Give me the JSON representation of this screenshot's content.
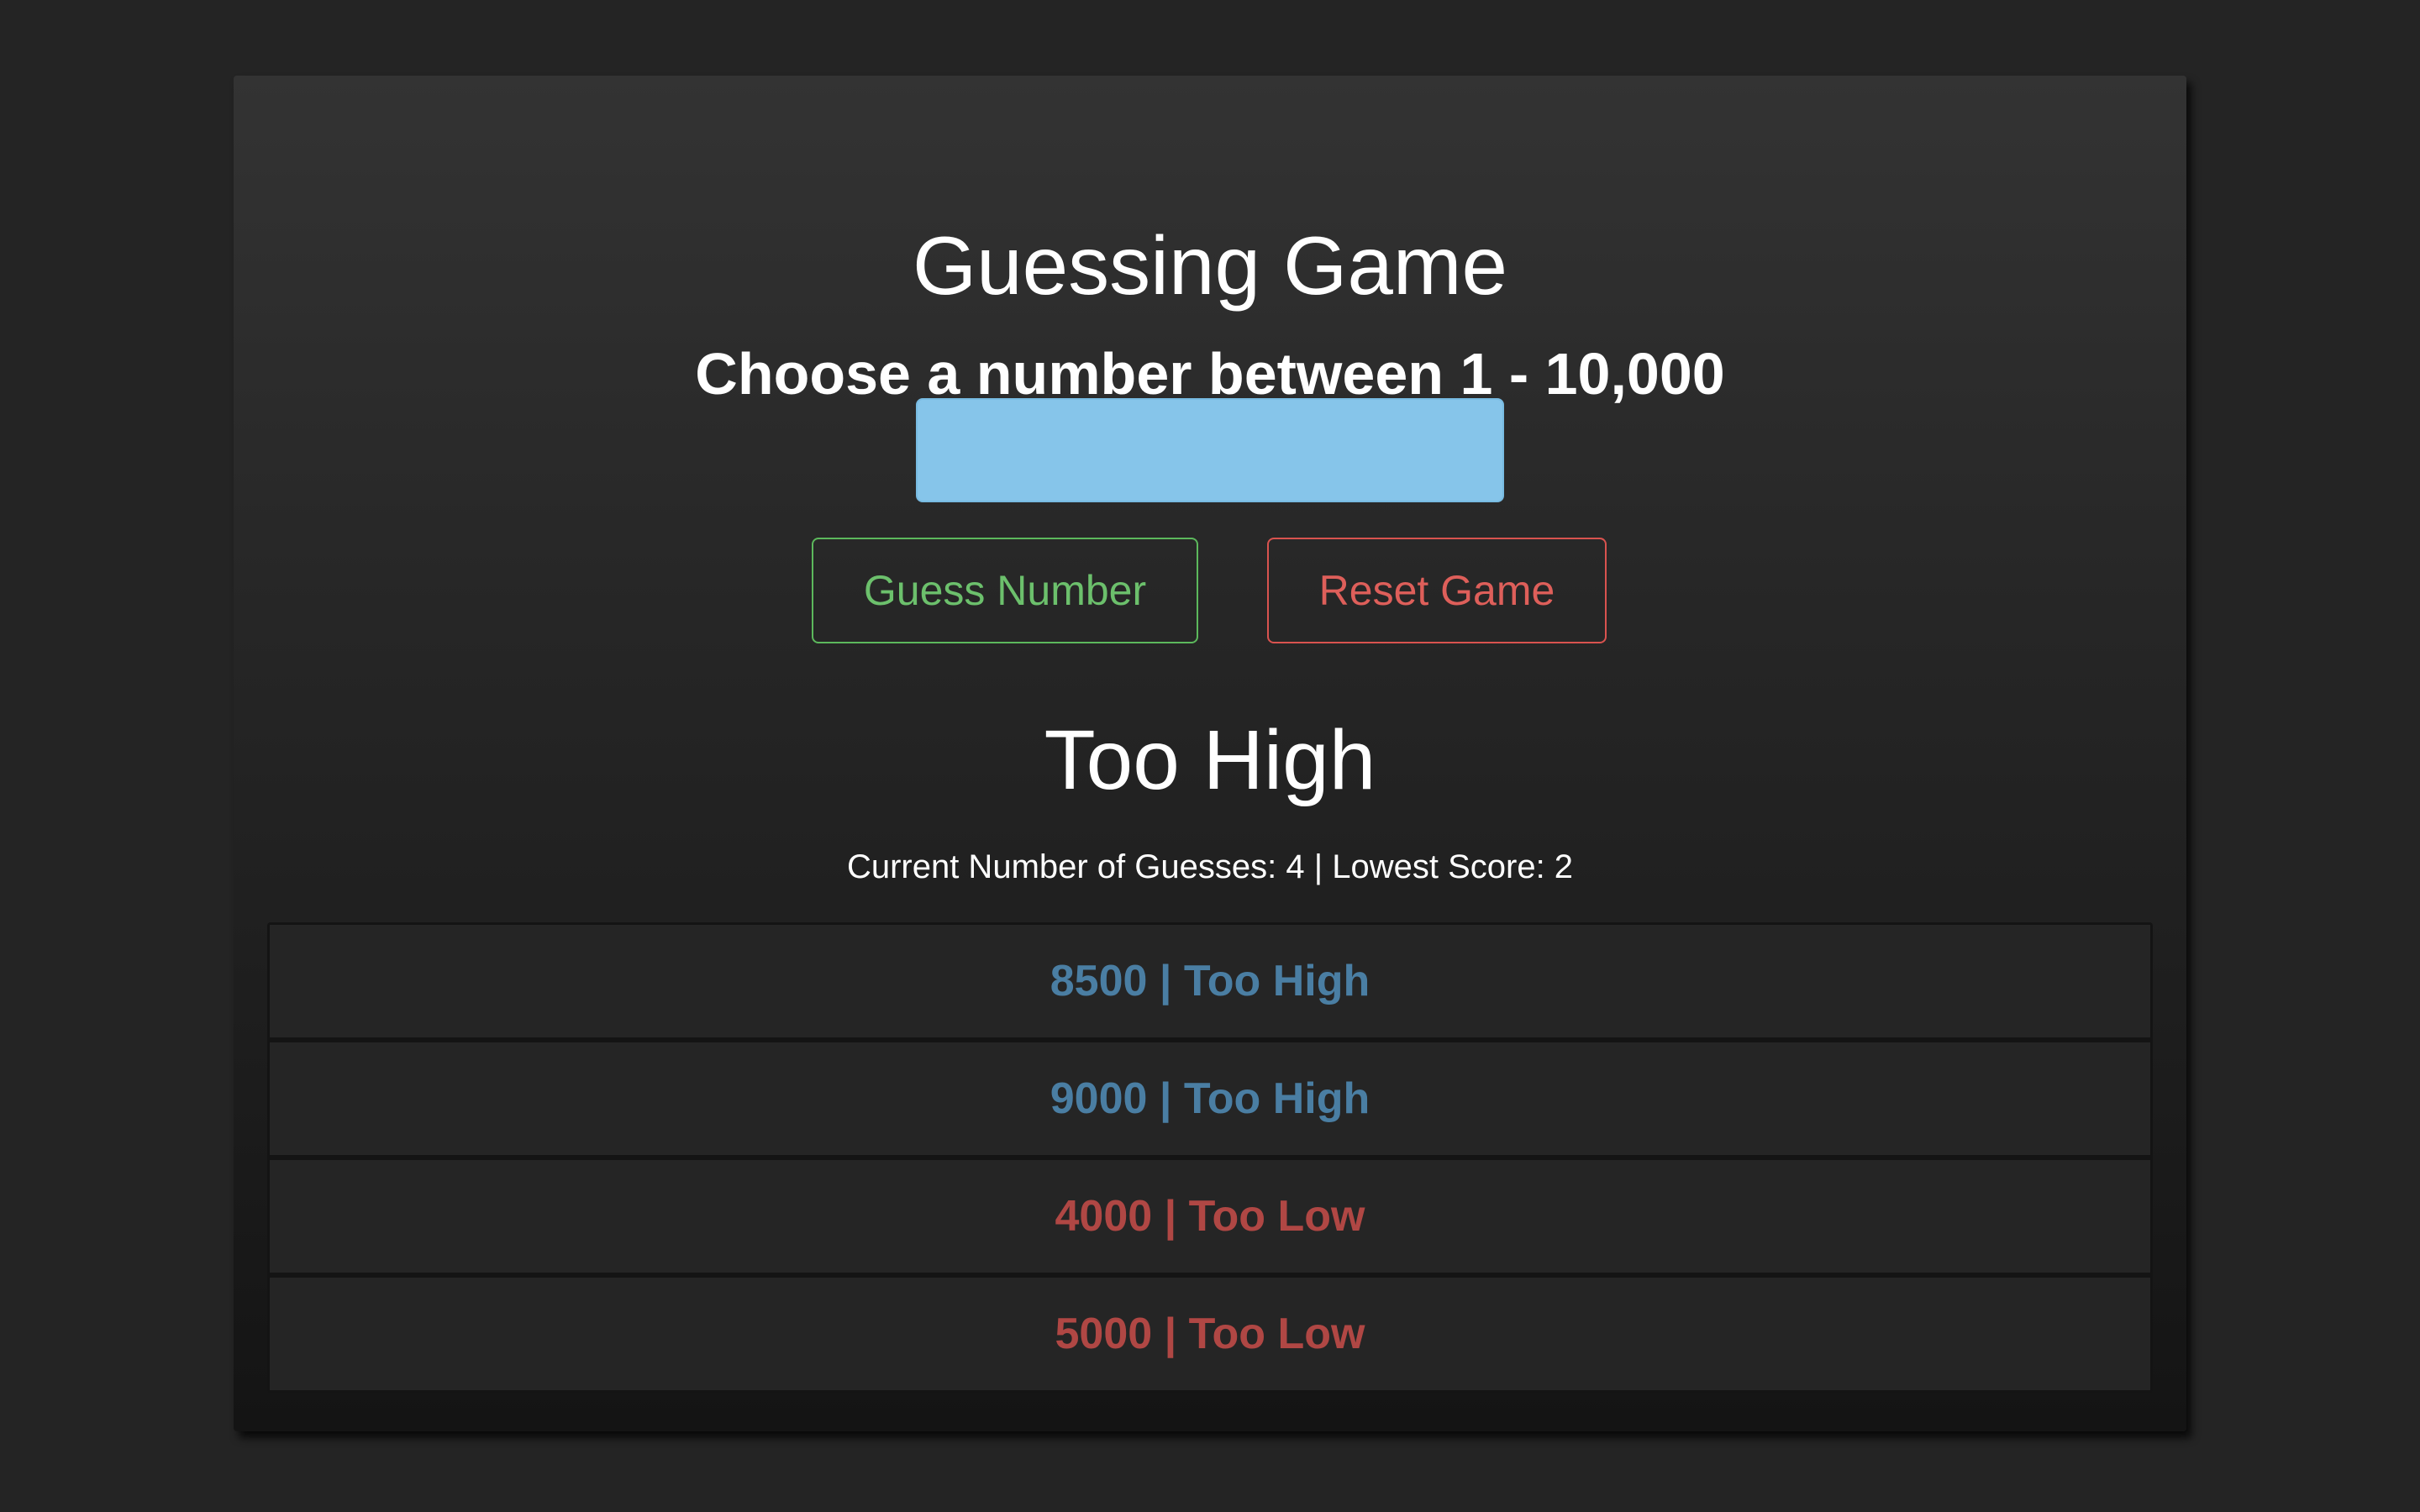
{
  "app": {
    "title": "Guessing Game",
    "subtitle": "Choose a number between 1 - 10,000"
  },
  "input": {
    "value": "",
    "placeholder": ""
  },
  "buttons": {
    "guess_label": "Guess Number",
    "reset_label": "Reset Game"
  },
  "result": {
    "text": "Too High"
  },
  "stats": {
    "text": "Current Number of Guesses: 4 | Lowest Score: 2",
    "current_guesses": 4,
    "lowest_score": 2
  },
  "history": [
    {
      "text": "8500 | Too High",
      "status": "high"
    },
    {
      "text": "9000 | Too High",
      "status": "high"
    },
    {
      "text": "4000 | Too Low",
      "status": "low"
    },
    {
      "text": "5000 | Too Low",
      "status": "low"
    }
  ],
  "colors": {
    "background": "#242424",
    "input": "#86c5ea",
    "guess_button": "#5cb85c",
    "reset_button": "#d9534f",
    "too_high": "#4a7ea3",
    "too_low": "#b04744"
  }
}
